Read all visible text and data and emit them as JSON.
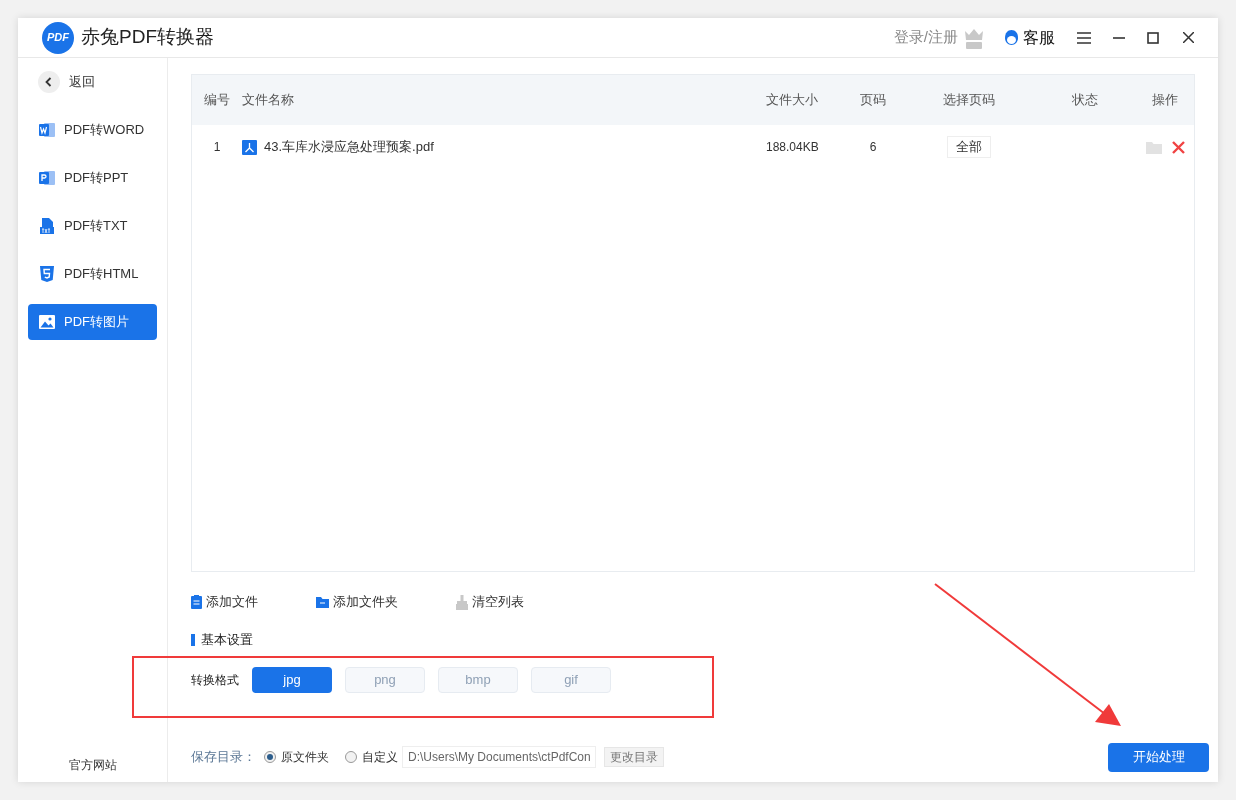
{
  "window": {
    "title": "赤兔PDF转换器",
    "logo": "PDF"
  },
  "header": {
    "login": "登录/注册",
    "support": "客服"
  },
  "sidebar": {
    "back": "返回",
    "items": [
      {
        "label": "PDF转WORD",
        "selected": false
      },
      {
        "label": "PDF转PPT",
        "selected": false
      },
      {
        "label": "PDF转TXT",
        "selected": false
      },
      {
        "label": "PDF转HTML",
        "selected": false
      },
      {
        "label": "PDF转图片",
        "selected": true
      }
    ],
    "footer": "官方网站"
  },
  "table": {
    "columns": [
      "编号",
      "文件名称",
      "文件大小",
      "页码",
      "选择页码",
      "状态",
      "操作"
    ],
    "rows": [
      {
        "no": "1",
        "name": "43.车库水浸应急处理预案.pdf",
        "size": "188.04KB",
        "pages": "6",
        "page_select": "全部"
      }
    ]
  },
  "toolbar": [
    "添加文件",
    "添加文件夹",
    "清空列表"
  ],
  "settings": {
    "title": "基本设置",
    "format_label": "转换格式",
    "formats": [
      {
        "label": "jpg",
        "selected": true
      },
      {
        "label": "png",
        "selected": false
      },
      {
        "label": "bmp",
        "selected": false
      },
      {
        "label": "gif",
        "selected": false
      }
    ]
  },
  "save": {
    "label": "保存目录：",
    "options": [
      {
        "label": "原文件夹",
        "selected": true
      },
      {
        "label": "自定义",
        "selected": false
      }
    ],
    "path": "D:\\Users\\My Documents\\ctPdfCon",
    "change": "更改目录"
  },
  "start": "开始处理"
}
